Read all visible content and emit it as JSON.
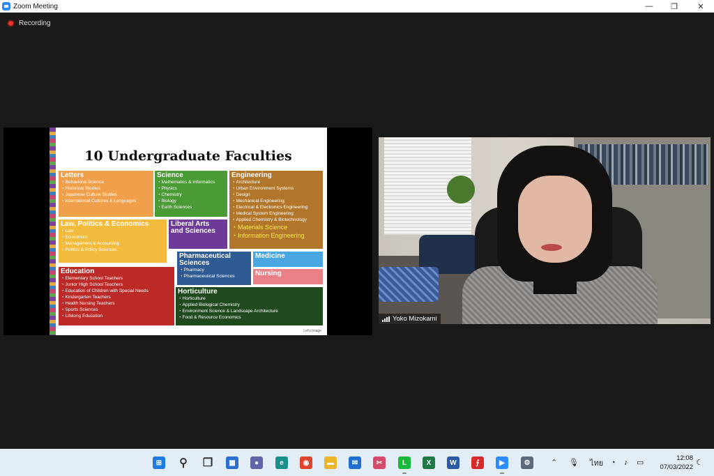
{
  "window": {
    "title": "Zoom Meeting",
    "minimize": "—",
    "maximize": "❐",
    "close": "✕"
  },
  "recording": {
    "label": "Recording"
  },
  "slide": {
    "title": "10 Undergraduate Faculties",
    "credit": "Let's Image",
    "faculties": [
      {
        "name": "Letters",
        "color": "#f0a04b",
        "items": [
          "・Behavioral Science",
          "・Historical Studies",
          "・Japanese Culture Studies",
          "・International Cultures & Languages"
        ],
        "extra": []
      },
      {
        "name": "Science",
        "color": "#4a9a35",
        "items": [
          "・Mathematics & Informatics",
          "・Physics",
          "・Chemistry",
          "・Biology",
          "・Earth Sciences"
        ],
        "extra": []
      },
      {
        "name": "Engineering",
        "color": "#b1762a",
        "items": [
          "・Architecture",
          "・Urban Environment Systems",
          "・Design",
          "・Mechanical Engineering",
          "・Electrical & Electronics Engineering",
          "・Medical System Engineering",
          "・Applied Chemistry & Biotechnology"
        ],
        "extra": [
          "・Materials Science",
          "・Information Engineering"
        ]
      },
      {
        "name": "Law, Politics & Economics",
        "color": "#f3bb3c",
        "items": [
          "・Law",
          "・Economics",
          "・Management & Accounting",
          "・Politics & Policy Sciences"
        ],
        "extra": []
      },
      {
        "name": "Liberal Arts and Sciences",
        "color": "#6d3a97",
        "items": [],
        "extra": []
      },
      {
        "name": "Pharmaceutical Sciences",
        "color": "#2f5b95",
        "items": [
          "・Pharmacy",
          "・Pharmaceutical Sciences"
        ],
        "extra": []
      },
      {
        "name": "Medicine",
        "color": "#4aa6e0",
        "items": [],
        "extra": []
      },
      {
        "name": "Nursing",
        "color": "#eb7f86",
        "items": [],
        "extra": []
      },
      {
        "name": "Education",
        "color": "#bb2a26",
        "items": [
          "・Elementary School Teachers",
          "・Junior High School Teachers",
          "・Education of Children with Special Needs",
          "・Kindergarten Teachers",
          "・Health Nursing Teachers",
          "・Sports Sciences",
          "・Lifelong Education"
        ],
        "extra": []
      },
      {
        "name": "Horticulture",
        "color": "#1e4a1e",
        "items": [
          "・Horticulture",
          "・Applied Biological Chemistry",
          "・Environment Science & Landscape Architecture",
          "・Food & Resource Economics"
        ],
        "extra": []
      }
    ]
  },
  "video": {
    "participant": "Yoko Mizokami"
  },
  "taskbar": {
    "apps": [
      {
        "name": "start",
        "color": "#1f7be0",
        "glyph": "⊞"
      },
      {
        "name": "search",
        "color": "#333333",
        "glyph": "⚲"
      },
      {
        "name": "task-view",
        "color": "#333333",
        "glyph": "❐"
      },
      {
        "name": "widgets",
        "color": "#2b6fd0",
        "glyph": "▦"
      },
      {
        "name": "chat",
        "color": "#6264a7",
        "glyph": "●"
      },
      {
        "name": "edge",
        "color": "#1a8f8a",
        "glyph": "e"
      },
      {
        "name": "chrome",
        "color": "#e0432b",
        "glyph": "◉"
      },
      {
        "name": "file-explorer",
        "color": "#e8b626",
        "glyph": "▬"
      },
      {
        "name": "mail",
        "color": "#1f6fd0",
        "glyph": "✉"
      },
      {
        "name": "snipping-tool",
        "color": "#d84a6a",
        "glyph": "✂"
      },
      {
        "name": "line",
        "color": "#19b83a",
        "glyph": "L"
      },
      {
        "name": "excel",
        "color": "#1d7a44",
        "glyph": "X"
      },
      {
        "name": "word",
        "color": "#2a5aa8",
        "glyph": "W"
      },
      {
        "name": "acrobat",
        "color": "#d82a2a",
        "glyph": "⨍"
      },
      {
        "name": "zoom",
        "color": "#2d8cff",
        "glyph": "▶"
      },
      {
        "name": "settings",
        "color": "#5a6a7a",
        "glyph": "⚙"
      }
    ],
    "language": "ไทย",
    "time": "12:08",
    "date": "07/03/2022"
  }
}
